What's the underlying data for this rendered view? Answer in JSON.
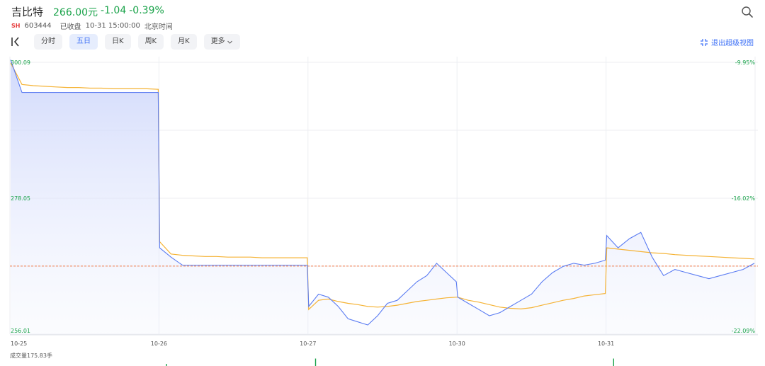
{
  "stock": {
    "name": "吉比特",
    "price": "266.00元",
    "change": "-1.04",
    "change_pct": "-0.39%",
    "exchange": "SH",
    "code": "603444",
    "status": "已收盘",
    "datetime": "10-31 15:00:00",
    "timezone": "北京时间"
  },
  "toolbar": {
    "tabs": [
      {
        "label": "分时",
        "active": false
      },
      {
        "label": "五日",
        "active": true
      },
      {
        "label": "日K",
        "active": false
      },
      {
        "label": "周K",
        "active": false
      },
      {
        "label": "月K",
        "active": false
      }
    ],
    "more_label": "更多",
    "exit_super_view": "退出超级视图"
  },
  "icons": {
    "search": "search-icon",
    "collapse": "collapse-sidebar-icon",
    "more_chevron": "chevron-down-icon",
    "fullscreen": "fullscreen-exit-icon"
  },
  "colors": {
    "up": "#e63b3b",
    "down": "#1aa34a",
    "price_line": "#5b7cf2",
    "avg_line": "#f5b335",
    "prev_close_line": "#f07b4a",
    "accent": "#3a6ef6"
  },
  "volume": {
    "label": "成交量175.83手"
  },
  "chart_data": {
    "type": "line",
    "title": "",
    "y_labels_left": [
      "300.09",
      "278.05",
      "256.01"
    ],
    "y_labels_right": [
      "-9.95%",
      "-16.02%",
      "-22.09%"
    ],
    "ylim": [
      256.01,
      300.09
    ],
    "prev_close": 267.04,
    "days": [
      "10-25",
      "10-26",
      "10-27",
      "10-30",
      "10-31"
    ],
    "series": [
      {
        "key": "price",
        "values": [
          [
            300.5,
            295.2,
            295.2,
            295.2,
            295.2,
            295.2,
            295.2,
            295.2,
            295.2,
            295.2,
            295.2,
            295.2,
            295.2,
            295.2
          ],
          [
            270.0,
            268.5,
            267.2,
            267.2,
            267.2,
            267.2,
            267.2,
            267.2,
            267.2,
            267.2,
            267.2,
            267.2,
            267.2,
            267.2
          ],
          [
            260.5,
            262.5,
            262.0,
            260.5,
            258.5,
            258.0,
            257.5,
            259.0,
            261.0,
            261.5,
            263.0,
            264.5,
            265.5,
            267.5,
            266.0,
            264.5
          ],
          [
            262.0,
            261.0,
            260.0,
            259.0,
            259.5,
            260.5,
            261.5,
            262.5,
            264.5,
            266.0,
            267.0,
            267.5,
            267.2,
            267.5,
            268.0
          ],
          [
            272.0,
            270.0,
            271.5,
            272.5,
            268.5,
            265.5,
            266.5,
            266.0,
            265.5,
            265.0,
            265.5,
            266.0,
            266.5,
            267.5
          ]
        ]
      },
      {
        "key": "average",
        "values": [
          [
            300.0,
            296.5,
            296.3,
            296.2,
            296.1,
            296.0,
            296.0,
            295.9,
            295.9,
            295.8,
            295.8,
            295.8,
            295.8,
            295.7
          ],
          [
            271.0,
            269.0,
            268.8,
            268.7,
            268.6,
            268.6,
            268.5,
            268.5,
            268.5,
            268.4,
            268.4,
            268.4,
            268.4,
            268.4
          ],
          [
            260.0,
            261.5,
            261.7,
            261.3,
            261.0,
            260.8,
            260.5,
            260.4,
            260.5,
            260.7,
            261.0,
            261.3,
            261.5,
            261.7,
            261.9,
            262.0
          ],
          [
            262.0,
            261.5,
            261.2,
            260.8,
            260.4,
            260.2,
            260.1,
            260.3,
            260.7,
            261.1,
            261.5,
            261.8,
            262.2,
            262.4,
            262.6
          ],
          [
            270.0,
            269.8,
            269.6,
            269.4,
            269.2,
            269.1,
            268.9,
            268.8,
            268.7,
            268.6,
            268.5,
            268.4,
            268.3,
            268.2
          ]
        ]
      }
    ],
    "volume": [
      0.1,
      0.35,
      0.0,
      0.35,
      0.0
    ],
    "grid": true
  }
}
